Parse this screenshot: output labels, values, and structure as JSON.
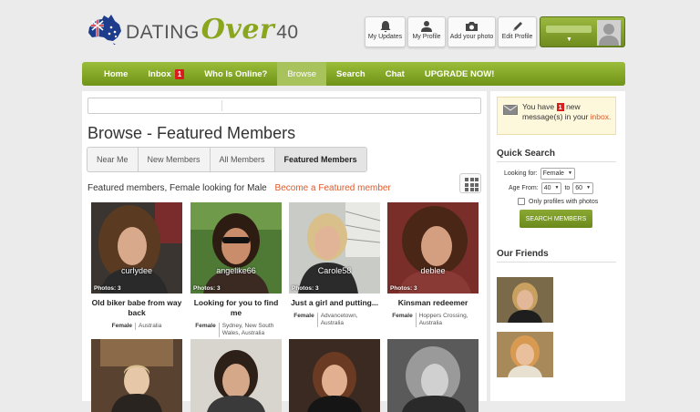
{
  "brand": {
    "dating": "DATING",
    "over": "Over",
    "age": "40"
  },
  "header_buttons": [
    {
      "label": "My Updates",
      "icon": "bell-icon"
    },
    {
      "label": "My Profile",
      "icon": "user-icon"
    },
    {
      "label": "Add your photo",
      "icon": "camera-icon"
    },
    {
      "label": "Edit Profile",
      "icon": "pencil-icon"
    }
  ],
  "nav": {
    "items": [
      "Home",
      "Inbox",
      "Who Is Online?",
      "Browse",
      "Search",
      "Chat",
      "UPGRADE NOW!"
    ],
    "inbox_count": "1",
    "active": "Browse"
  },
  "main": {
    "title": "Browse - Featured Members",
    "tabs": [
      "Near Me",
      "New Members",
      "All Members",
      "Featured Members"
    ],
    "active_tab": "Featured Members",
    "featured_text": "Featured members, Female looking for Male",
    "become_link": "Become a Featured member"
  },
  "members": [
    {
      "username": "curlydee",
      "photos": "Photos: 3",
      "headline": "Old biker babe from way back",
      "gender": "Female",
      "location": "Australia"
    },
    {
      "username": "angelike66",
      "photos": "Photos: 3",
      "headline": "Looking for you to find me",
      "gender": "Female",
      "location": "Sydney, New South Wales, Australia"
    },
    {
      "username": "Carole58",
      "photos": "Photos: 3",
      "headline": "Just a girl and putting...",
      "gender": "Female",
      "location": "Advancetown, Australia"
    },
    {
      "username": "deblee",
      "photos": "Photos: 3",
      "headline": "Kinsman redeemer",
      "gender": "Female",
      "location": "Hoppers Crossing, Australia"
    }
  ],
  "sidebar": {
    "msg_prefix": "You have",
    "msg_count": "1",
    "msg_suffix": "new message(s) in your",
    "msg_link": "inbox.",
    "quick_search": "Quick Search",
    "looking_for_label": "Looking for:",
    "looking_for_value": "Female",
    "age_from_label": "Age From:",
    "age_from": "40",
    "age_to_label": "to",
    "age_to": "60",
    "only_photos": "Only profiles with photos",
    "search_button": "SEARCH MEMBERS",
    "friends_title": "Our Friends"
  },
  "colors": {
    "accent_green": "#7a9c22",
    "badge_red": "#d61e1e",
    "link_orange": "#e05a2b"
  }
}
